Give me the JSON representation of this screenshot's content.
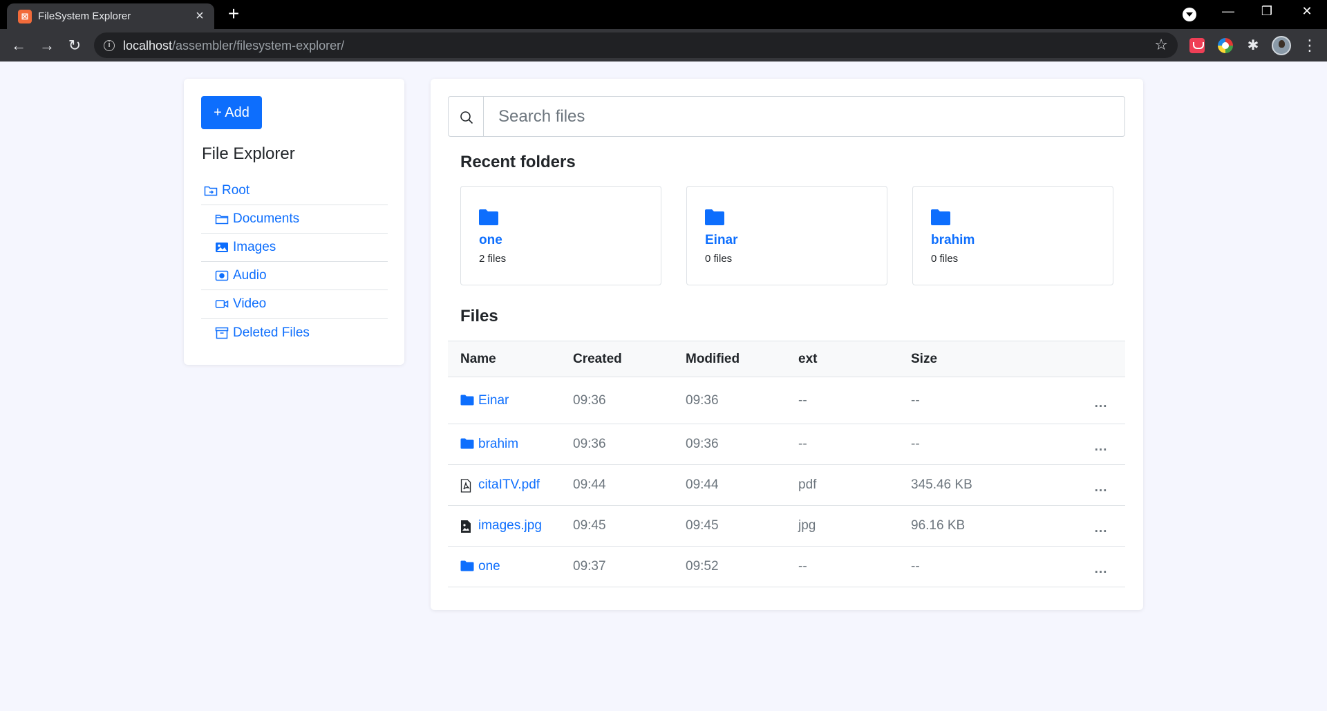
{
  "browser": {
    "tab_title": "FileSystem Explorer",
    "tab_favicon": "xampp-icon",
    "url_host": "localhost",
    "url_path": "/assembler/filesystem-explorer/"
  },
  "sidebar": {
    "add_label": "+ Add",
    "title": "File Explorer",
    "items": [
      {
        "label": "Root",
        "icon": "folder-symlink-icon"
      },
      {
        "label": "Documents",
        "icon": "folder-icon"
      },
      {
        "label": "Images",
        "icon": "image-icon"
      },
      {
        "label": "Audio",
        "icon": "audio-icon"
      },
      {
        "label": "Video",
        "icon": "video-icon"
      },
      {
        "label": "Deleted Files",
        "icon": "archive-icon"
      }
    ]
  },
  "search": {
    "placeholder": "Search files",
    "icon": "search-icon"
  },
  "recent": {
    "title": "Recent folders",
    "folders": [
      {
        "name": "one",
        "count": "2 files"
      },
      {
        "name": "Einar",
        "count": "0 files"
      },
      {
        "name": "brahim",
        "count": "0 files"
      }
    ]
  },
  "files": {
    "title": "Files",
    "columns": [
      "Name",
      "Created",
      "Modified",
      "ext",
      "Size"
    ],
    "rows": [
      {
        "name": "Einar",
        "icon": "folder-icon",
        "created": "09:36",
        "modified": "09:36",
        "ext": "--",
        "size": "--",
        "menu": "..."
      },
      {
        "name": "brahim",
        "icon": "folder-icon",
        "created": "09:36",
        "modified": "09:36",
        "ext": "--",
        "size": "--",
        "menu": "..."
      },
      {
        "name": "citaITV.pdf",
        "icon": "pdf-file-icon",
        "created": "09:44",
        "modified": "09:44",
        "ext": "pdf",
        "size": "345.46 KB",
        "menu": "..."
      },
      {
        "name": "images.jpg",
        "icon": "image-file-icon",
        "created": "09:45",
        "modified": "09:45",
        "ext": "jpg",
        "size": "96.16 KB",
        "menu": "..."
      },
      {
        "name": "one",
        "icon": "folder-icon",
        "created": "09:37",
        "modified": "09:52",
        "ext": "--",
        "size": "--",
        "menu": "..."
      }
    ]
  },
  "colors": {
    "primary": "#0d6efd",
    "page_bg": "#f5f6fe",
    "muted_text": "#6c757d"
  }
}
